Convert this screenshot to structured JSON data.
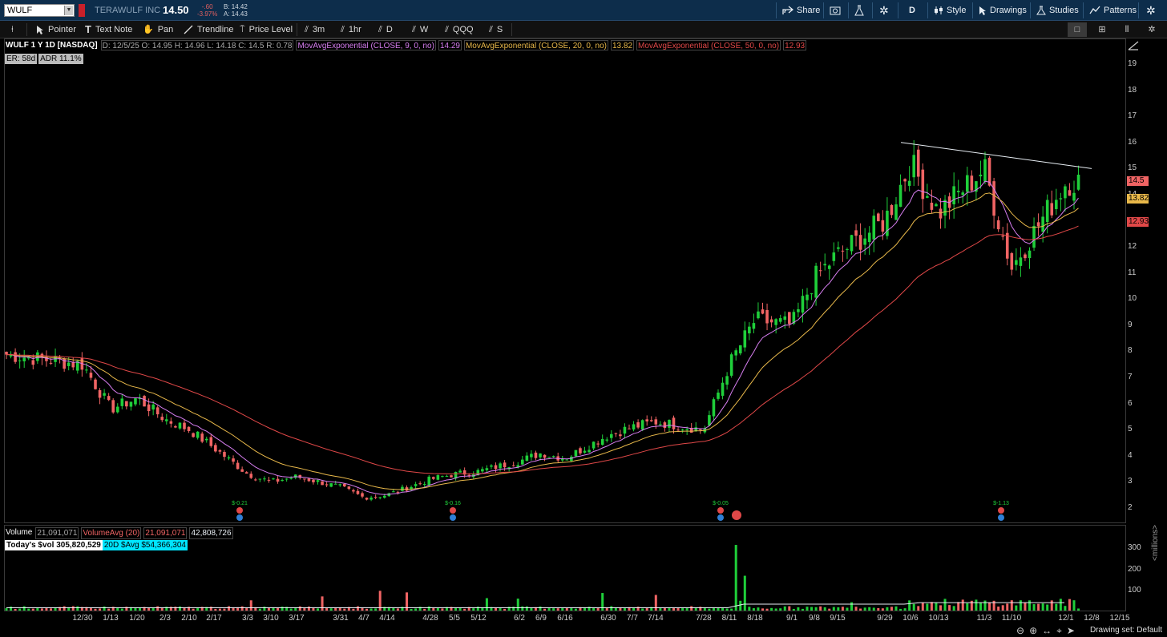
{
  "header": {
    "symbol": "WULF",
    "company": "TERAWULF INC",
    "last_price": "14.50",
    "net_change": "-.60",
    "pct_change": "-3.97%",
    "bid": "B: 14.42",
    "ask": "A: 14.43",
    "share_label": "Share",
    "timeframe_label": "D",
    "style_label": "Style",
    "drawings_label": "Drawings",
    "studies_label": "Studies",
    "patterns_label": "Patterns"
  },
  "toolbar": {
    "pointer": "Pointer",
    "text_note": "Text Note",
    "pan": "Pan",
    "trendline": "Trendline",
    "price_level": "Price Level",
    "tf_3m": "3m",
    "tf_1hr": "1hr",
    "tf_d": "D",
    "tf_w": "W",
    "qqq": "QQQ",
    "s": "S"
  },
  "legend": {
    "title": "WULF 1 Y 1D [NASDAQ]",
    "ohlc": "D: 12/5/25  O: 14.95  H: 14.96  L: 14.18  C: 14.5  R: 0.78",
    "ema9": "MovAvgExponential (CLOSE, 9, 0, no)",
    "ema9_val": "14.29",
    "ema20": "MovAvgExponential (CLOSE, 20, 0, no)",
    "ema20_val": "13.82",
    "ema50": "MovAvgExponential (CLOSE, 50, 0, no)",
    "ema50_val": "12.93",
    "er": "ER: 58d",
    "adr": "ADR 11.1%"
  },
  "price_axis": [
    "19",
    "18",
    "17",
    "16",
    "15",
    "14",
    "13",
    "12",
    "11",
    "10",
    "9",
    "8",
    "7",
    "6",
    "5",
    "4",
    "3",
    "2"
  ],
  "price_tags": {
    "close": "14.5",
    "ema20": "13.82",
    "ema50": "12.93"
  },
  "earnings": [
    {
      "label": "$-0.21",
      "date": "3/3"
    },
    {
      "label": "$-0.16",
      "date": "5/12"
    },
    {
      "label": "$-0.05",
      "date": "8/11"
    },
    {
      "label": "$-1.13",
      "date": "11/10"
    }
  ],
  "volume": {
    "label": "Volume",
    "value": "21,091,071",
    "avg_label": "VolumeAvg (20)",
    "avg_value": "21,091,071",
    "avg2": "42,808,726",
    "todays_dollar_vol": "Today's $vol 305,820,529",
    "avg_dollar_vol": "20D $Avg $54,366,304",
    "axis": [
      "300",
      "200",
      "100"
    ],
    "unit": "<millions>"
  },
  "date_axis": [
    "12/30",
    "1/13",
    "1/20",
    "2/3",
    "2/10",
    "2/17",
    "3/3",
    "3/10",
    "3/17",
    "3/31",
    "4/7",
    "4/14",
    "4/28",
    "5/5",
    "5/12",
    "6/2",
    "6/9",
    "6/16",
    "6/30",
    "7/7",
    "7/14",
    "7/28",
    "8/11",
    "8/18",
    "9/1",
    "9/8",
    "9/15",
    "9/29",
    "10/6",
    "10/13",
    "11/3",
    "11/10",
    "12/1",
    "12/8",
    "12/15"
  ],
  "status": {
    "drawing_set": "Drawing set: Default"
  },
  "chart_data": {
    "type": "candlestick",
    "title": "WULF 1 Y 1D [NASDAQ]",
    "ylim": [
      1.6,
      19.6
    ],
    "y_scale": "linear",
    "grid": false,
    "x_dates": [
      "12/30",
      "1/13",
      "1/20",
      "2/3",
      "2/10",
      "2/17",
      "3/3",
      "3/10",
      "3/17",
      "3/31",
      "4/7",
      "4/14",
      "4/28",
      "5/5",
      "5/12",
      "6/2",
      "6/9",
      "6/16",
      "6/30",
      "7/7",
      "7/14",
      "7/28",
      "8/11",
      "8/18",
      "9/1",
      "9/8",
      "9/15",
      "9/29",
      "10/6",
      "10/13",
      "11/3",
      "11/10",
      "12/1"
    ],
    "close_approx": [
      7.5,
      5.8,
      6.2,
      5.4,
      5.0,
      4.3,
      3.3,
      3.0,
      3.2,
      2.8,
      2.4,
      2.5,
      3.1,
      3.3,
      3.4,
      3.8,
      4.1,
      3.9,
      4.8,
      5.1,
      5.3,
      5.0,
      7.5,
      9.2,
      9.0,
      10.8,
      11.7,
      13.0,
      15.2,
      13.3,
      15.0,
      11.2,
      14.5
    ],
    "series": [
      {
        "name": "MovAvgExponential (CLOSE, 9, 0, no)",
        "color": "#d77ef0",
        "last": 14.29
      },
      {
        "name": "MovAvgExponential (CLOSE, 20, 0, no)",
        "color": "#e8b84a",
        "last": 13.82
      },
      {
        "name": "MovAvgExponential (CLOSE, 50, 0, no)",
        "color": "#e04848",
        "last": 12.93
      }
    ],
    "volume_ylim": [
      0,
      340
    ],
    "volume_spike": {
      "date": "8/11",
      "value": 330
    }
  },
  "colors": {
    "up": "#1fcf3a",
    "down": "#f06464",
    "ema9": "#d77ef0",
    "ema20": "#e8b84a",
    "ema50": "#e04848",
    "header_bg": "#0d2d4b",
    "dollar_avg_bg": "#00e5ff"
  }
}
